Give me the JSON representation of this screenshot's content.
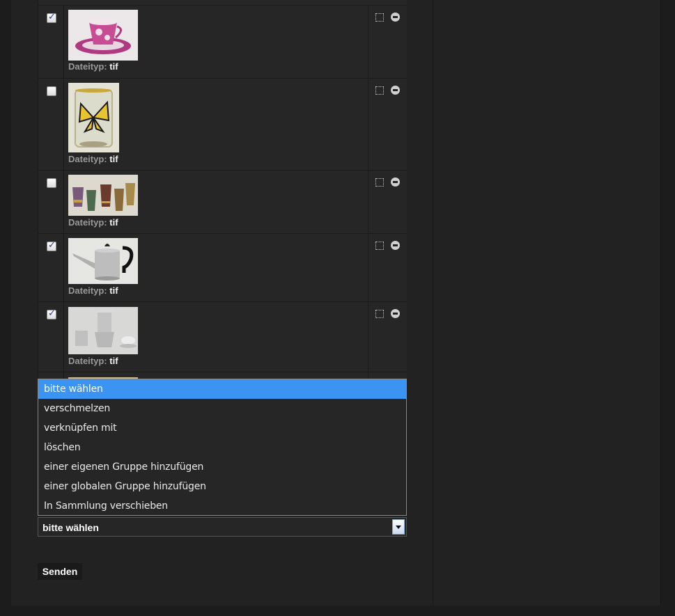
{
  "rows": [
    {
      "checked": true,
      "thumb": "cup-and-saucer",
      "label": "Dateityp:",
      "value": "tif"
    },
    {
      "checked": false,
      "thumb": "butterfly-glass",
      "label": "Dateityp:",
      "value": "tif"
    },
    {
      "checked": false,
      "thumb": "beakers",
      "label": "Dateityp:",
      "value": "tif"
    },
    {
      "checked": true,
      "thumb": "teapot",
      "label": "Dateityp:",
      "value": "tif"
    },
    {
      "checked": true,
      "thumb": "coffee-set",
      "label": "Dateityp:",
      "value": "tif"
    }
  ],
  "actions": {
    "select_icon": "dotted-square-icon",
    "remove_icon": "minus-circle-icon"
  },
  "action_select": {
    "value": "bitte wählen",
    "options": [
      "bitte wählen",
      "verschmelzen",
      "verknüpfen mit",
      "löschen",
      "einer eigenen Gruppe hinzufügen",
      "einer globalen Gruppe hinzufügen",
      "In Sammlung verschieben"
    ]
  },
  "send_label": "Senden",
  "colors": {
    "highlight": "#3b94f2",
    "background": "#222222"
  }
}
